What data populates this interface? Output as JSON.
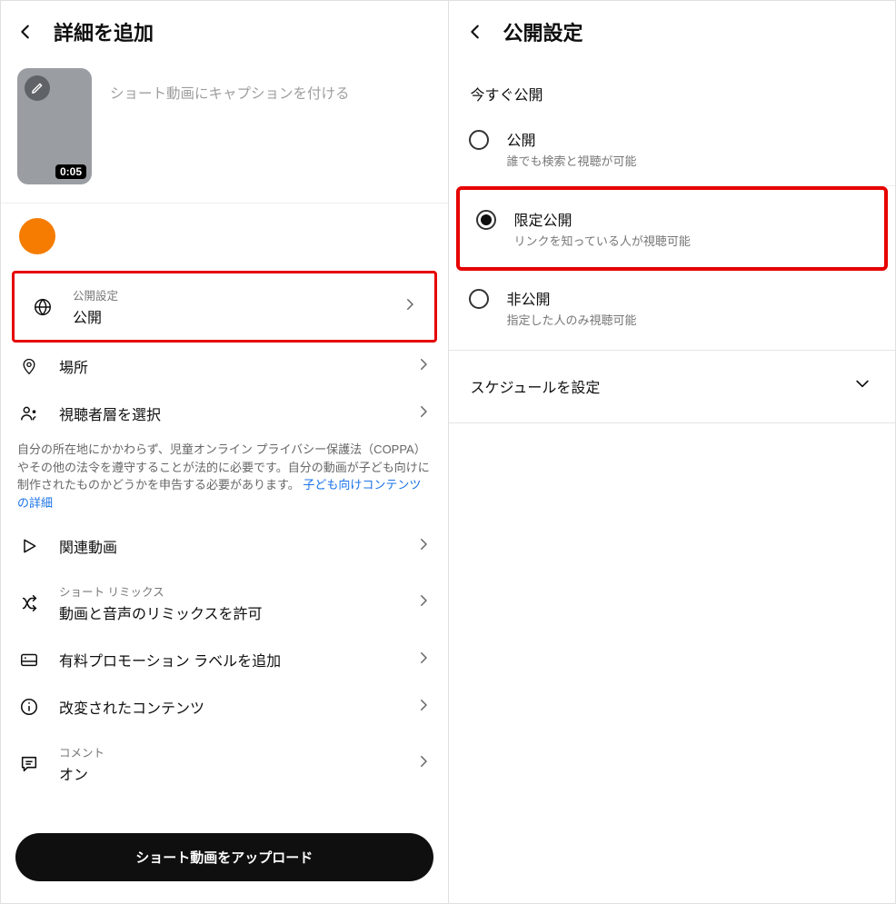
{
  "left": {
    "title": "詳細を追加",
    "caption_placeholder": "ショート動画にキャプションを付ける",
    "duration": "0:05",
    "items": {
      "visibility": {
        "overline": "公開設定",
        "label": "公開"
      },
      "location": {
        "label": "場所"
      },
      "audience": {
        "label": "視聴者層を選択"
      },
      "related": {
        "label": "関連動画"
      },
      "remix": {
        "overline": "ショート リミックス",
        "label": "動画と音声のリミックスを許可"
      },
      "paid": {
        "label": "有料プロモーション ラベルを追加"
      },
      "altered": {
        "label": "改変されたコンテンツ"
      },
      "comments": {
        "overline": "コメント",
        "label": "オン"
      }
    },
    "help_text": "自分の所在地にかかわらず、児童オンライン プライバシー保護法（COPPA）やその他の法令を遵守することが法的に必要です。自分の動画が子ども向けに制作されたものかどうかを申告する必要があります。",
    "help_link": "子ども向けコンテンツの詳細",
    "upload_button": "ショート動画をアップロード"
  },
  "right": {
    "title": "公開設定",
    "section": "今すぐ公開",
    "options": {
      "public": {
        "title": "公開",
        "sub": "誰でも検索と視聴が可能",
        "selected": false
      },
      "unlisted": {
        "title": "限定公開",
        "sub": "リンクを知っている人が視聴可能",
        "selected": true
      },
      "private": {
        "title": "非公開",
        "sub": "指定した人のみ視聴可能",
        "selected": false
      }
    },
    "schedule": "スケジュールを設定"
  }
}
